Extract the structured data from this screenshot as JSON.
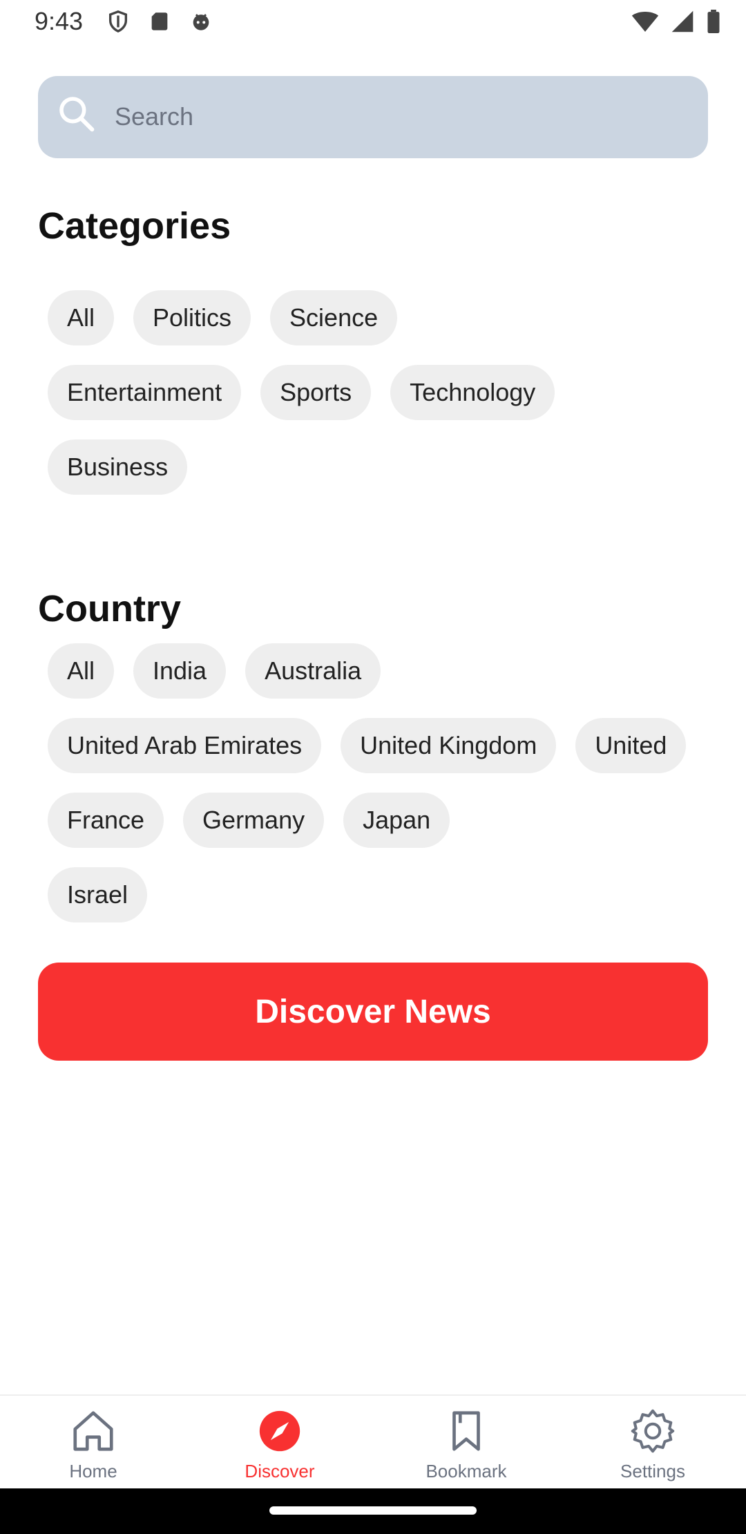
{
  "status_bar": {
    "time": "9:43",
    "icons_left": [
      "shield-icon",
      "sd-card-icon",
      "android-face-icon"
    ],
    "icons_right": [
      "wifi-icon",
      "signal-icon",
      "battery-icon"
    ]
  },
  "search": {
    "placeholder": "Search"
  },
  "categories": {
    "title": "Categories",
    "rows": [
      [
        "All",
        "Politics",
        "Science"
      ],
      [
        "Entertainment",
        "Sports",
        "Technology"
      ],
      [
        "Business"
      ]
    ]
  },
  "country": {
    "title": "Country",
    "rows": [
      [
        "All",
        "India",
        "Australia"
      ],
      [
        "United Arab Emirates",
        "United Kingdom",
        "United"
      ],
      [
        "France",
        "Germany",
        "Japan"
      ],
      [
        "Israel"
      ]
    ]
  },
  "cta": {
    "label": "Discover News"
  },
  "bottom_nav": {
    "items": [
      {
        "label": "Home",
        "icon": "home-icon",
        "active": false
      },
      {
        "label": "Discover",
        "icon": "compass-icon",
        "active": true
      },
      {
        "label": "Bookmark",
        "icon": "bookmark-icon",
        "active": false
      },
      {
        "label": "Settings",
        "icon": "gear-icon",
        "active": false
      }
    ]
  },
  "colors": {
    "accent": "#f83131",
    "search_bg": "#cbd5e1",
    "chip_bg": "#eeeeee"
  }
}
